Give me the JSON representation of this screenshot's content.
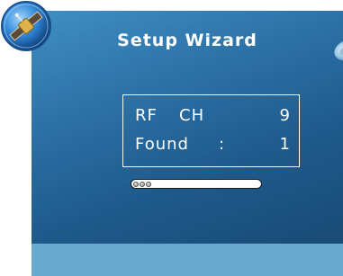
{
  "window": {
    "title": "Setup Wizard"
  },
  "info": {
    "rf_label_1": "RF",
    "rf_label_2": "CH",
    "rf_value": "9",
    "found_label": "Found",
    "found_colon": ":",
    "found_value": "1"
  },
  "progress": {
    "level": 0.2,
    "dots": 3
  },
  "icons": {
    "top_left": "satellite-icon",
    "top_right": "satellite-dish-icon"
  },
  "colors": {
    "background_top": "#3f8fc4",
    "background_bottom": "#17476f",
    "bottom_band": "#6aa9d0",
    "text": "#ffffff"
  }
}
